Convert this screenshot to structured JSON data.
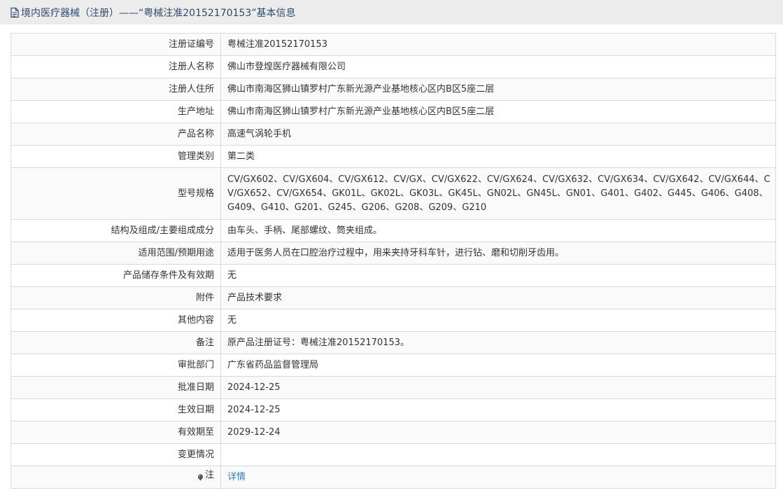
{
  "header": {
    "title": "境内医疗器械（注册）——“粤械注准20152170153”基本信息",
    "icon": "document-icon"
  },
  "rows": [
    {
      "label": "注册证编号",
      "value": "粤械注准20152170153"
    },
    {
      "label": "注册人名称",
      "value": "佛山市登煌医疗器械有限公司"
    },
    {
      "label": "注册人住所",
      "value": "佛山市南海区狮山镇罗村广东新光源产业基地核心区内B区5座二层"
    },
    {
      "label": "生产地址",
      "value": "佛山市南海区狮山镇罗村广东新光源产业基地核心区内B区5座二层"
    },
    {
      "label": "产品名称",
      "value": "高速气涡轮手机"
    },
    {
      "label": "管理类别",
      "value": "第二类"
    },
    {
      "label": "型号规格",
      "value": "CV/GX602、CV/GX604、CV/GX612、CV/GX、CV/GX622、CV/GX624、CV/GX632、CV/GX634、CV/GX642、CV/GX644、CV/GX652、CV/GX654、GK01L、GK02L、GK03L、GK45L、GN02L、GN45L、GN01、G401、G402、G445、G406、G408、G409、G410、G201、G245、G206、G208、G209、G210"
    },
    {
      "label": "结构及组成/主要组成成分",
      "value": "由车头、手柄、尾部螺纹、筒夹组成。"
    },
    {
      "label": "适用范围/预期用途",
      "value": "适用于医务人员在口腔治疗过程中，用来夹持牙科车针，进行钻、磨和切削牙齿用。"
    },
    {
      "label": "产品储存条件及有效期",
      "value": "无"
    },
    {
      "label": "附件",
      "value": "产品技术要求"
    },
    {
      "label": "其他内容",
      "value": "无"
    },
    {
      "label": "备注",
      "value": "原产品注册证号：粤械注准20152170153。"
    },
    {
      "label": "审批部门",
      "value": "广东省药品监督管理局"
    },
    {
      "label": "批准日期",
      "value": "2024-12-25"
    },
    {
      "label": "生效日期",
      "value": "2024-12-25"
    },
    {
      "label": "有效期至",
      "value": "2029-12-24"
    },
    {
      "label": "变更情况",
      "value": ""
    }
  ],
  "note": {
    "label": "注",
    "icon": "pin-icon",
    "link_text": "详情",
    "link_color": "#2f7fc1"
  }
}
